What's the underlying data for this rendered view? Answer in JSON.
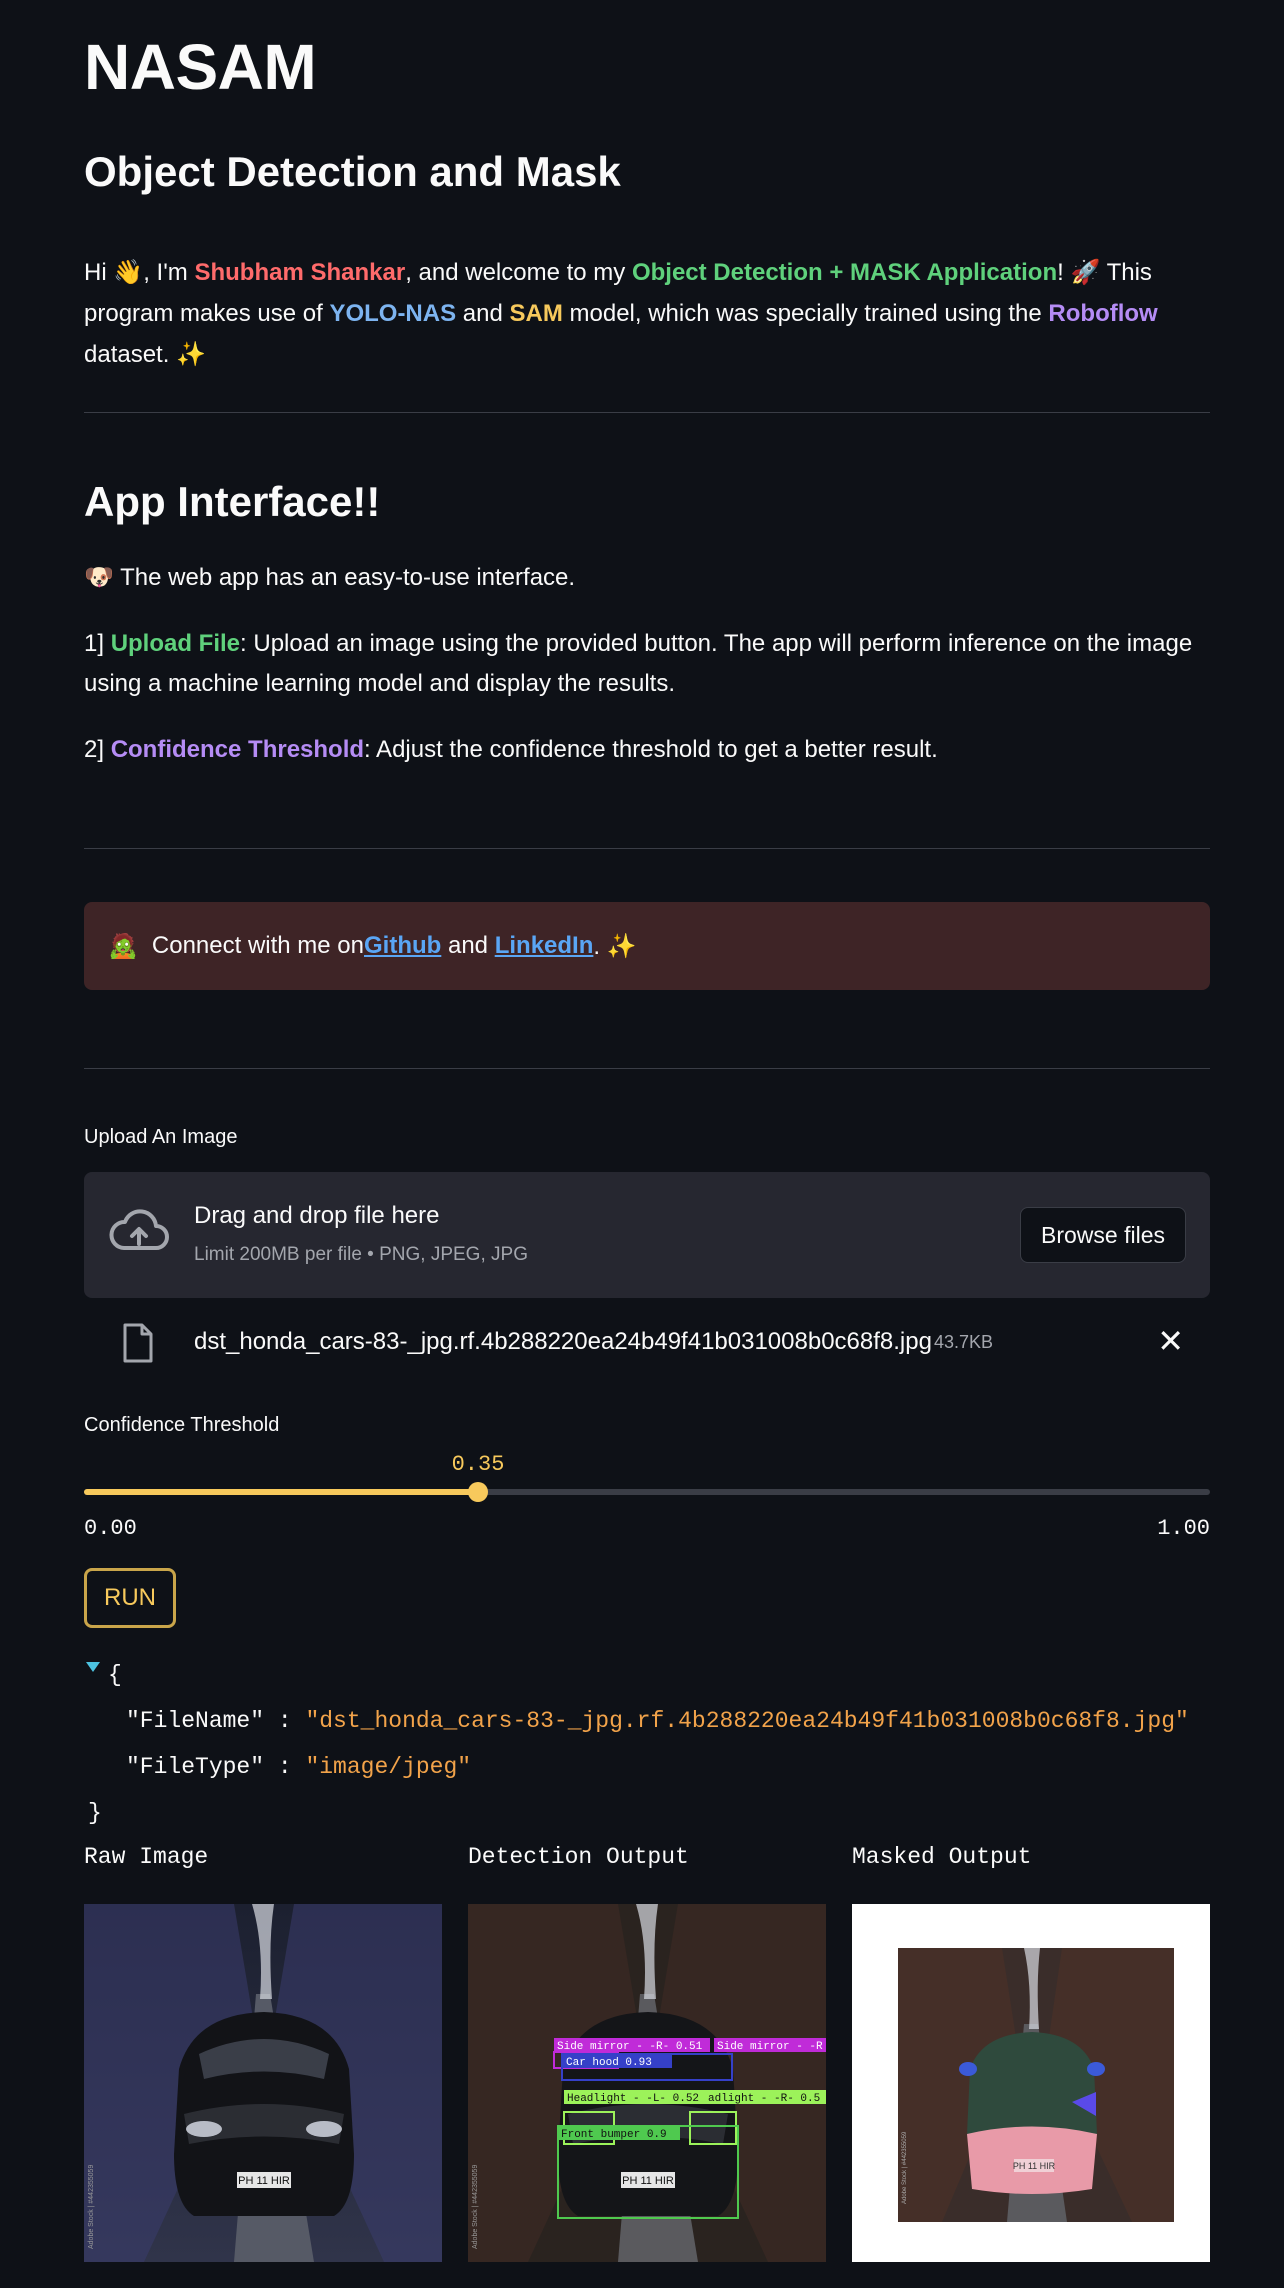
{
  "header": {
    "title": "NASAM",
    "subtitle": "Object Detection and Mask"
  },
  "intro": {
    "p1": "Hi 👋, I'm ",
    "author": "Shubham Shankar",
    "p2": ", and welcome to my ",
    "app_name": "Object Detection + MASK Application",
    "p3": "! 🚀 This program makes use of ",
    "model1": "YOLO-NAS",
    "p4": " and ",
    "model2": "SAM",
    "p5": " model, which was specially trained using the ",
    "dataset": "Roboflow",
    "p6": " dataset. ✨"
  },
  "interface": {
    "title": "App Interface!!",
    "desc": "🐶 The web app has an easy-to-use interface.",
    "item1_num": "1] ",
    "item1_title": "Upload File",
    "item1_text": ": Upload an image using the provided button. The app will perform inference on the image using a machine learning model and display the results.",
    "item2_num": "2] ",
    "item2_title": "Confidence Threshold",
    "item2_text": ": Adjust the confidence threshold to get a better result."
  },
  "connect": {
    "emoji": "🧟",
    "text1": "Connect with me on ",
    "github": "Github",
    "text2": " and ",
    "linkedin": "LinkedIn",
    "text3": ". ✨"
  },
  "upload": {
    "label": "Upload An Image",
    "dz_title": "Drag and drop file here",
    "dz_limit": "Limit 200MB per file • PNG, JPEG, JPG",
    "browse_label": "Browse files",
    "file_name": "dst_honda_cars-83-_jpg.rf.4b288220ea24b49f41b031008b0c68f8.jpg",
    "file_size": "43.7KB"
  },
  "slider": {
    "label": "Confidence Threshold",
    "value": 0.35,
    "value_text": "0.35",
    "min_text": "0.00",
    "max_text": "1.00"
  },
  "run_label": "RUN",
  "json_output": {
    "open": "{",
    "close": "}",
    "key1": "\"FileName\"",
    "val1": "\"dst_honda_cars-83-_jpg.rf.4b288220ea24b49f41b031008b0c68f8.jpg\"",
    "key2": "\"FileType\"",
    "val2": "\"image/jpeg\"",
    "sep": " : "
  },
  "outputs": {
    "raw_label": "Raw Image",
    "detection_label": "Detection Output",
    "masked_label": "Masked Output",
    "plate_text": "PH 11 HIR",
    "watermark": "Adobe Stock | #442355059",
    "detections": [
      {
        "label": "Side mirror - -R- 0.51",
        "color": "#c02bd8"
      },
      {
        "label": "Side mirror - -R",
        "color": "#c02bd8"
      },
      {
        "label": "Car hood 0.93",
        "color": "#3540c8"
      },
      {
        "label": "Headlight - -L- 0.52",
        "color": "#9cf25a"
      },
      {
        "label": "adlight - -R- 0.5",
        "color": "#9cf25a"
      },
      {
        "label": "Front bumper 0.9",
        "color": "#4fc94f"
      }
    ]
  },
  "colors": {
    "background": "#0e1117",
    "accent": "#f7c95c",
    "link": "#5aa6f5",
    "dropzone": "#262730",
    "connect_bg": "#3e2426"
  }
}
